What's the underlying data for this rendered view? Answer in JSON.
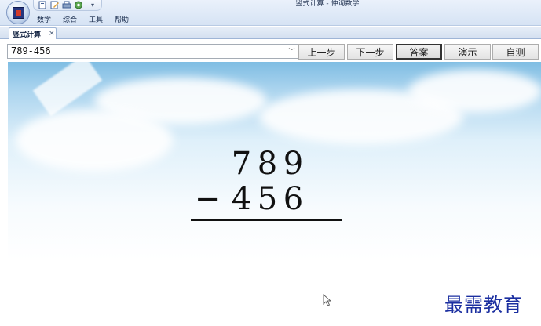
{
  "app": {
    "title": "竖式计算 - 仲询数学"
  },
  "menu": {
    "items": [
      "数学",
      "综合",
      "工具",
      "帮助"
    ]
  },
  "tabs": [
    {
      "label": "竖式计算",
      "close": "×"
    }
  ],
  "toolbar": {
    "expression_value": "789-456",
    "buttons": {
      "prev": "上一步",
      "next": "下一步",
      "answer": "答案",
      "demo": "演示",
      "self_test": "自测"
    }
  },
  "calculation": {
    "top": [
      "7",
      "8",
      "9"
    ],
    "operator": "−",
    "bottom": [
      "4",
      "5",
      "6"
    ]
  },
  "watermark": "最需教育",
  "colors": {
    "accent": "#1b2fa0",
    "sky": "#7fbde3"
  }
}
